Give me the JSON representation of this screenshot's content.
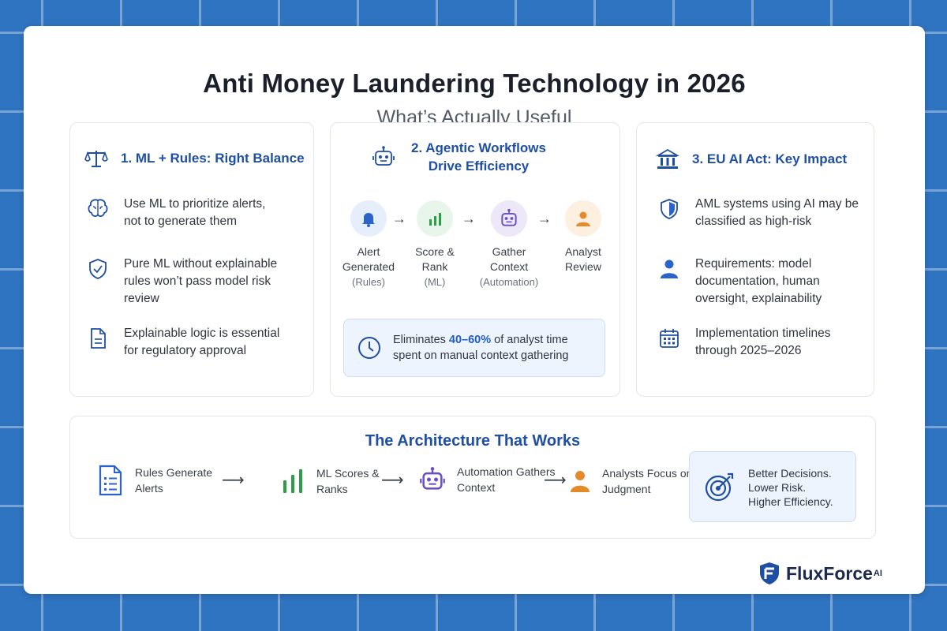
{
  "header": {
    "title": "Anti Money Laundering Technology in 2026",
    "subtitle": "What’s Actually Useful"
  },
  "card1": {
    "title": "1. ML + Rules: Right Balance",
    "items": [
      {
        "text_line1": "Use ML to prioritize alerts,",
        "text_line2": "not to generate them",
        "icon": "brain-icon"
      },
      {
        "text_line1": "Pure ML without explainable",
        "text_line2": "rules won’t pass model risk",
        "text_line3": "review",
        "icon": "shield-check-icon"
      },
      {
        "text_line1": "Explainable logic is essential",
        "text_line2": "for regulatory approval",
        "icon": "document-icon"
      }
    ]
  },
  "card2": {
    "title_line1": "2. Agentic Workflows",
    "title_line2": "Drive Efficiency",
    "flow": [
      {
        "line1": "Alert",
        "line2": "Generated",
        "sub": "(Rules)",
        "icon": "bell-icon"
      },
      {
        "line1": "Score &",
        "line2": "Rank",
        "sub": "(ML)",
        "icon": "bar-chart-icon"
      },
      {
        "line1": "Gather",
        "line2": "Context",
        "sub": "(Automation)",
        "icon": "robot-icon"
      },
      {
        "line1": "Analyst",
        "line2": "Review",
        "sub": "",
        "icon": "person-icon"
      }
    ],
    "arrow": "→",
    "callout": {
      "prefix": "Eliminates ",
      "highlight": "40–60%",
      "suffix": " of analyst time",
      "line2": "spent on manual context gathering"
    }
  },
  "card3": {
    "title": "3. EU AI Act: Key Impact",
    "items": [
      {
        "text_line1": "AML systems using AI may be",
        "text_line2": "classified as high-risk",
        "icon": "shield-icon"
      },
      {
        "text_line1": "Requirements: model",
        "text_line2": "documentation, human",
        "text_line3": "oversight, explainability",
        "icon": "person-icon"
      },
      {
        "text_line1": "Implementation timelines",
        "text_line2": "through 2025–2026",
        "icon": "calendar-icon"
      }
    ]
  },
  "architecture": {
    "title": "The Architecture That Works",
    "steps": [
      {
        "line1": "Rules Generate",
        "line2": "Alerts",
        "icon": "document-list-icon"
      },
      {
        "line1": "ML Scores &",
        "line2": "Ranks",
        "icon": "bar-chart-icon"
      },
      {
        "line1": "Automation Gathers",
        "line2": "Context",
        "icon": "robot-icon"
      },
      {
        "line1": "Analysts Focus on",
        "line2": "Judgment",
        "icon": "person-icon"
      }
    ],
    "arrow": "⟶",
    "result": {
      "line1": "Better Decisions.",
      "line2": "Lower Risk.",
      "line3": "Higher Efficiency.",
      "icon": "target-icon"
    }
  },
  "logo": {
    "name": "FluxForce",
    "sup": "AI"
  },
  "colors": {
    "accent": "#1f4fa3",
    "background": "#2f74c0",
    "green": "#2e9e44",
    "purple": "#6a4fc0",
    "orange": "#e58a2a"
  }
}
